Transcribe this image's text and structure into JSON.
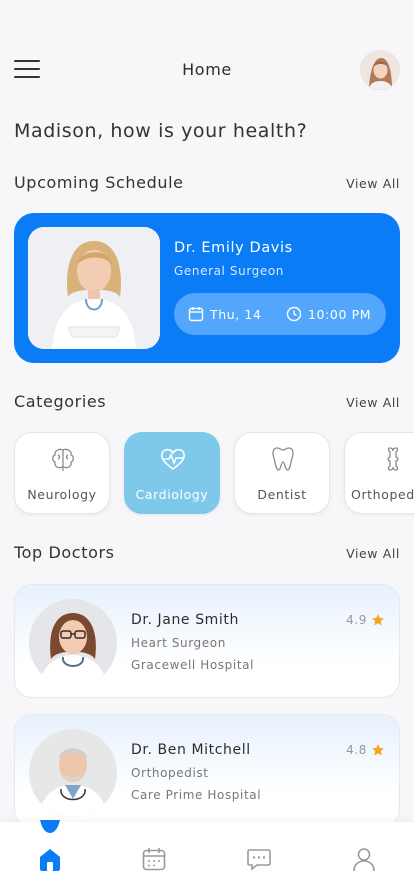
{
  "header": {
    "title": "Home"
  },
  "greeting": "Madison, how is your health?",
  "schedule": {
    "title": "Upcoming Schedule",
    "view_all": "View All",
    "doctor_name": "Dr. Emily Davis",
    "doctor_role": "General Surgeon",
    "date": "Thu, 14",
    "time": "10:00 PM"
  },
  "categories": {
    "title": "Categories",
    "view_all": "View All",
    "items": [
      {
        "label": "Neurology",
        "icon": "brain-icon",
        "active": false
      },
      {
        "label": "Cardiology",
        "icon": "heart-pulse-icon",
        "active": true
      },
      {
        "label": "Dentist",
        "icon": "tooth-icon",
        "active": false
      },
      {
        "label": "Orthoped",
        "icon": "bone-icon",
        "active": false
      }
    ]
  },
  "top_doctors": {
    "title": "Top Doctors",
    "view_all": "View All",
    "items": [
      {
        "name": "Dr. Jane Smith",
        "specialty": "Heart Surgeon",
        "hospital": "Gracewell Hospital",
        "rating": "4.9"
      },
      {
        "name": "Dr. Ben Mitchell",
        "specialty": "Orthopedist",
        "hospital": "Care Prime Hospital",
        "rating": "4.8"
      }
    ]
  },
  "tabbar": {
    "items": [
      "home-icon",
      "calendar-icon",
      "chat-icon",
      "profile-icon"
    ],
    "active": "home-icon"
  },
  "colors": {
    "primary": "#0a7cf5",
    "category_active": "#7ec9ea",
    "star": "#f5a623"
  }
}
